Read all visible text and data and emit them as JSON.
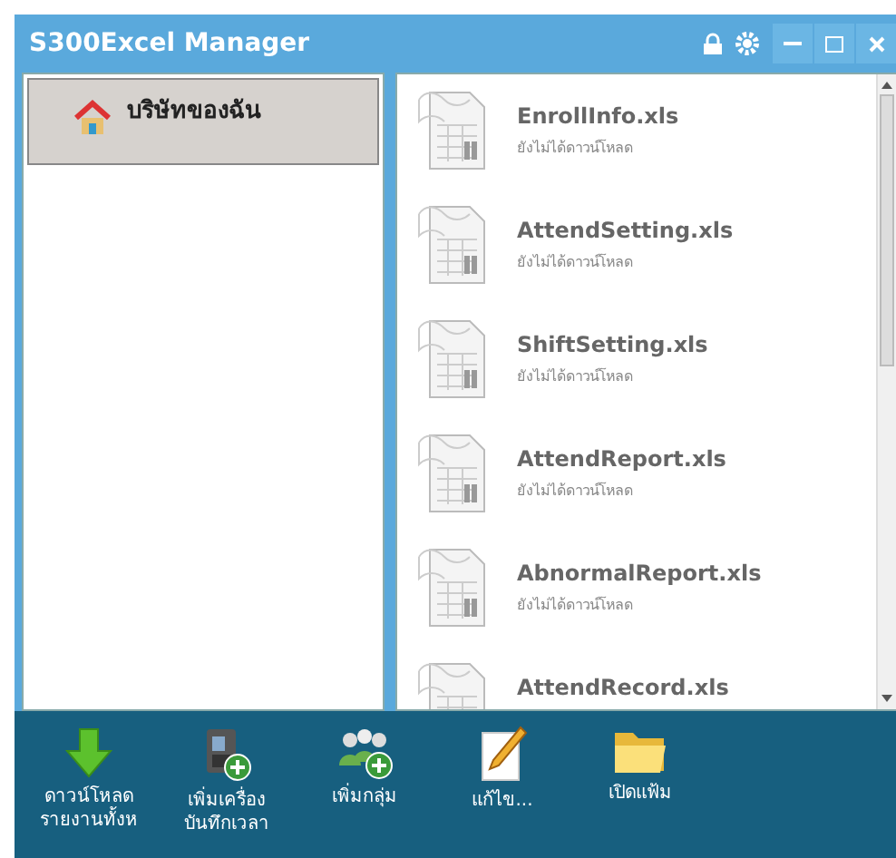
{
  "window": {
    "title": "S300Excel Manager"
  },
  "sidebar": {
    "items": [
      {
        "label": "บริษัทของฉัน",
        "selected": true
      }
    ]
  },
  "files": [
    {
      "name": "EnrollInfo.xls",
      "status": "ยังไม่ได้ดาวน์โหลด"
    },
    {
      "name": "AttendSetting.xls",
      "status": "ยังไม่ได้ดาวน์โหลด"
    },
    {
      "name": "ShiftSetting.xls",
      "status": "ยังไม่ได้ดาวน์โหลด"
    },
    {
      "name": "AttendReport.xls",
      "status": "ยังไม่ได้ดาวน์โหลด"
    },
    {
      "name": "AbnormalReport.xls",
      "status": "ยังไม่ได้ดาวน์โหลด"
    },
    {
      "name": "AttendRecord.xls"
    }
  ],
  "toolbar": [
    {
      "kind": "download",
      "label": "ดาวน์โหลด\nรายงานทั้งห"
    },
    {
      "kind": "device",
      "label": "เพิ่มเครื่อง\nบันทึกเวลา"
    },
    {
      "kind": "group",
      "label": "เพิ่มกลุ่ม"
    },
    {
      "kind": "edit",
      "label": "แก้ไข..."
    },
    {
      "kind": "folder",
      "label": "เปิดแฟ้ม"
    }
  ]
}
